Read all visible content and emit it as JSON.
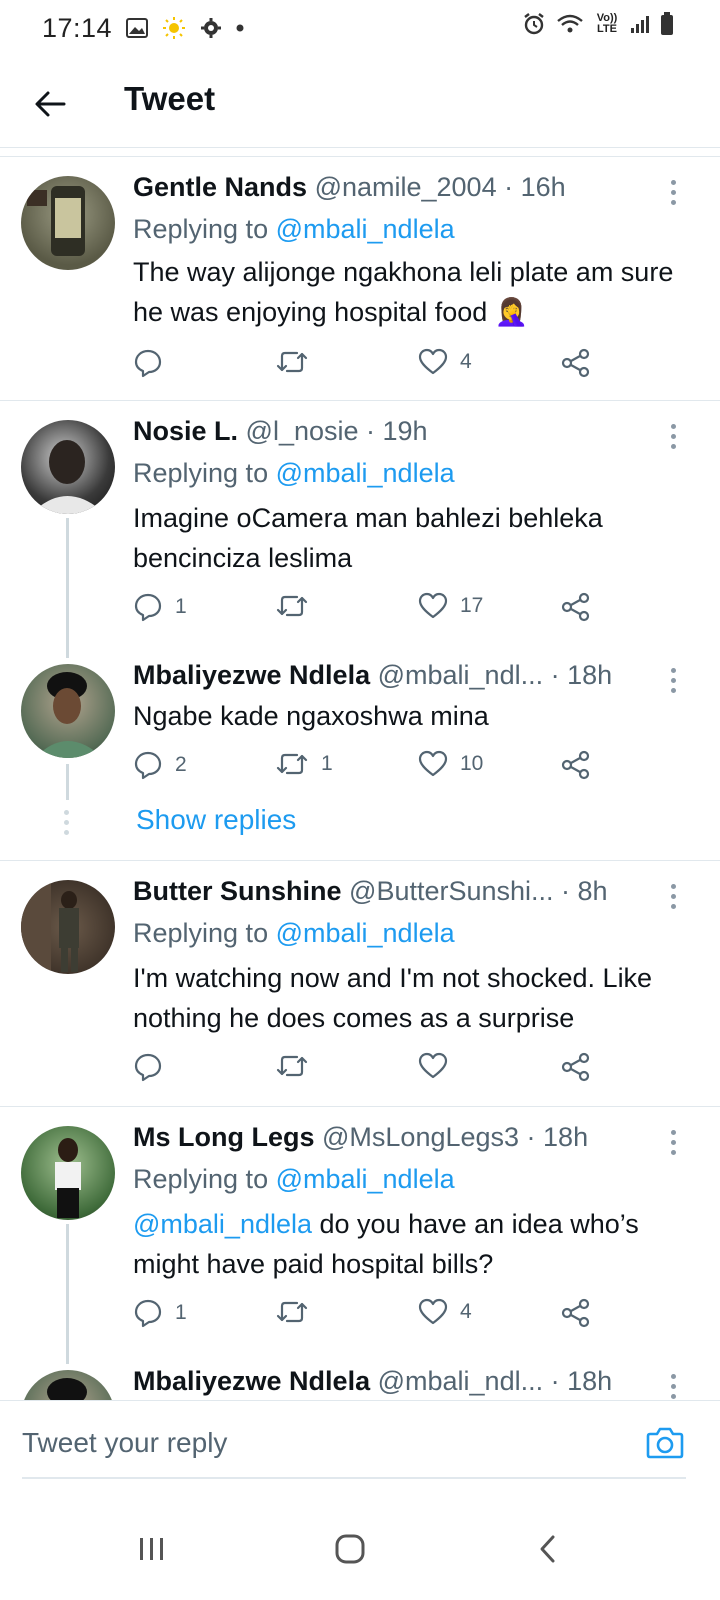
{
  "status_bar": {
    "time": "17:14",
    "lte_label": "Vo)) LTE"
  },
  "header": {
    "title": "Tweet"
  },
  "tweets": [
    {
      "name": "Gentle Nands",
      "handle": "@namile_2004 · 16h",
      "replying_prefix": "Replying to ",
      "replying_to": "@mbali_ndlela",
      "text": "The way alijonge ngakhona leli plate am sure he was enjoying hospital food 🤦‍♀️",
      "replies": "",
      "retweets": "",
      "likes": "4",
      "avatar_color": "#6b6b5a"
    },
    {
      "name": "Nosie L.",
      "handle": "@l_nosie · 19h",
      "replying_prefix": "Replying to ",
      "replying_to": "@mbali_ndlela",
      "text": "Imagine oCamera man bahlezi behleka bencinciza leslima",
      "replies": "1",
      "retweets": "",
      "likes": "17",
      "avatar_color": "#3a3a3a"
    },
    {
      "name": "Mbaliyezwe Ndlela",
      "handle": "@mbali_ndl... · 18h",
      "text": "Ngabe kade ngaxoshwa mina",
      "replies": "2",
      "retweets": "1",
      "likes": "10",
      "avatar_color": "#4b6b5a"
    },
    {
      "name": "Butter Sunshine",
      "handle": "@ButterSunshi... · 8h",
      "replying_prefix": "Replying to ",
      "replying_to": "@mbali_ndlela",
      "text": "I'm watching now and I'm not shocked. Like nothing he does comes as a surprise",
      "replies": "",
      "retweets": "",
      "likes": "",
      "avatar_color": "#4a3d33"
    },
    {
      "name": "Ms Long Legs",
      "handle": "@MsLongLegs3 · 18h",
      "replying_prefix": "Replying to ",
      "replying_to": "@mbali_ndlela",
      "text_mention": "@mbali_ndlela",
      "text": " do you have an idea who’s might have paid hospital bills?",
      "replies": "1",
      "retweets": "",
      "likes": "4",
      "avatar_color": "#3f6b3a"
    },
    {
      "name": "Mbaliyezwe Ndlela",
      "handle": "@mbali_ndl... · 18h",
      "avatar_color": "#4b6b5a"
    }
  ],
  "show_replies_label": "Show replies",
  "reply_box": {
    "placeholder": "Tweet your reply"
  },
  "colors": {
    "accent": "#1d9bf0",
    "muted": "#536471",
    "text": "#0f1419",
    "divider": "#e1e8ed"
  },
  "icons": [
    "back-arrow-icon",
    "more-icon",
    "reply-icon",
    "retweet-icon",
    "like-icon",
    "share-icon",
    "camera-icon",
    "recents-icon",
    "home-icon",
    "back-nav-icon"
  ]
}
